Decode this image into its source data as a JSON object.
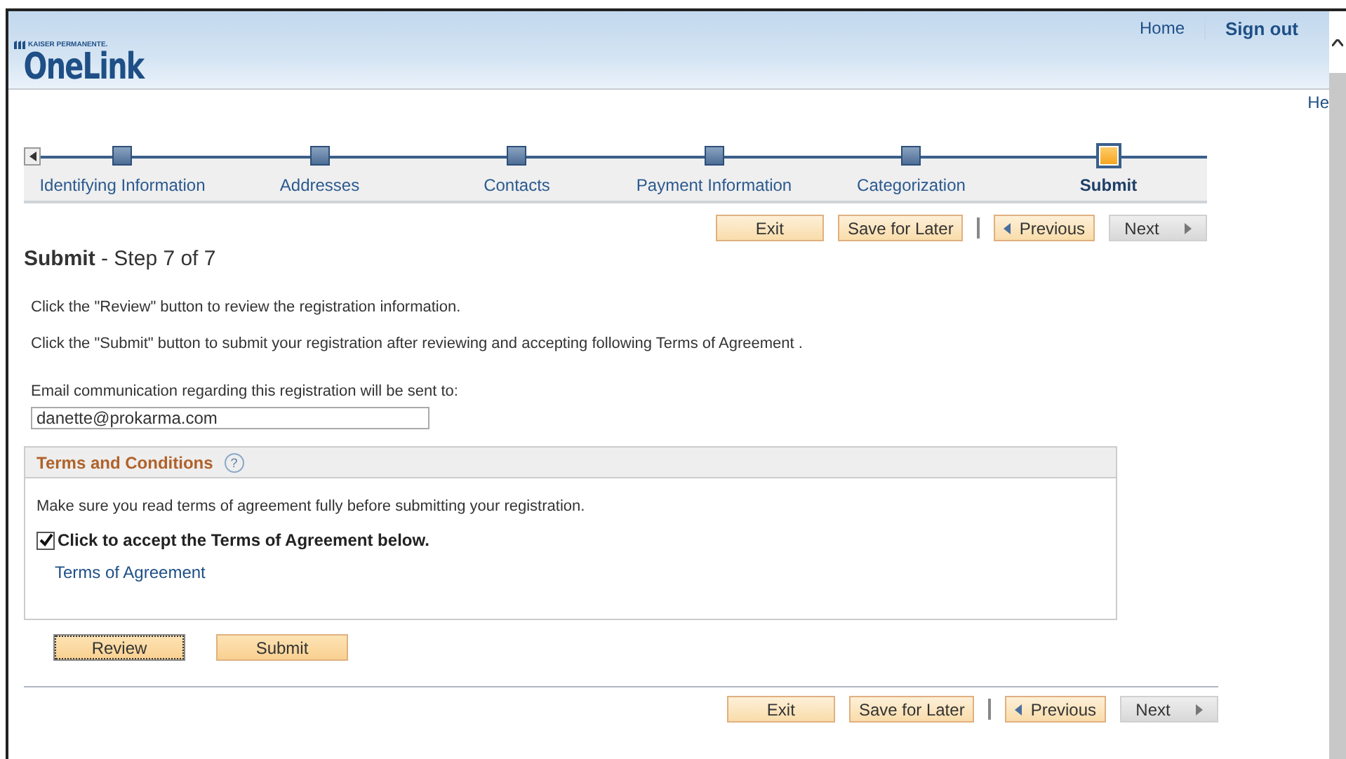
{
  "header": {
    "brand_small": "KAISER PERMANENTE.",
    "brand": "OneLink",
    "links": [
      {
        "label": "Home",
        "bold": false
      },
      {
        "label": "Sign out",
        "bold": true
      }
    ],
    "help_link": "He"
  },
  "steps": [
    {
      "label": "Identifying Information",
      "selected": false
    },
    {
      "label": "Addresses",
      "selected": false
    },
    {
      "label": "Contacts",
      "selected": false
    },
    {
      "label": "Payment Information",
      "selected": false
    },
    {
      "label": "Categorization",
      "selected": false
    },
    {
      "label": "Submit",
      "selected": true
    }
  ],
  "nav_top": [
    {
      "label": "Exit",
      "kind": "plain",
      "disabled": false
    },
    {
      "label": "Save for Later",
      "kind": "plain",
      "disabled": false
    },
    {
      "label": "Previous",
      "kind": "prev",
      "disabled": false
    },
    {
      "label": "Next",
      "kind": "next",
      "disabled": true
    }
  ],
  "page_title": {
    "name": "Submit",
    "step": " - Step 7 of 7"
  },
  "instructions": [
    "Click the \"Review\" button to review the registration information.",
    "Click the \"Submit\" button to submit your registration after reviewing and accepting following Terms of Agreement ."
  ],
  "email": {
    "label": "Email communication regarding this registration will be sent to:",
    "value": "danette@prokarma.com"
  },
  "terms": {
    "title": "Terms and Conditions",
    "help": "?",
    "note": "Make sure you read terms of agreement fully before submitting your registration.",
    "accept": {
      "label": "Click to accept the Terms of Agreement below.",
      "checked": true
    },
    "link": "Terms of Agreement"
  },
  "actions": [
    {
      "label": "Review",
      "focused": true
    },
    {
      "label": "Submit",
      "focused": false
    }
  ],
  "nav_bottom": [
    {
      "label": "Exit",
      "kind": "plain",
      "disabled": false
    },
    {
      "label": "Save for Later",
      "kind": "plain",
      "disabled": false
    },
    {
      "label": "Previous",
      "kind": "prev",
      "disabled": false
    },
    {
      "label": "Next",
      "kind": "next",
      "disabled": true
    }
  ]
}
